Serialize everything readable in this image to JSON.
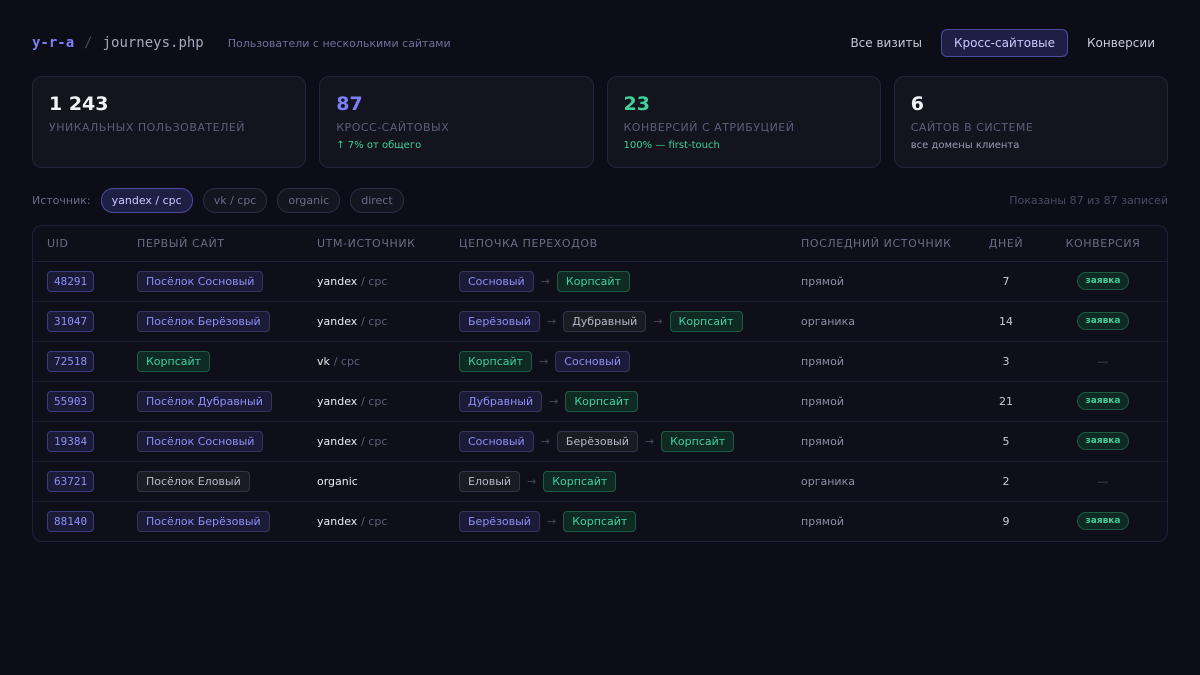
{
  "header": {
    "logo": "y-r-a",
    "separator": "/",
    "file": "journeys.php",
    "subtitle": "Пользователи с несколькими сайтами",
    "nav": [
      {
        "label": "Все визиты",
        "active": false
      },
      {
        "label": "Кросс-сайтовые",
        "active": true
      },
      {
        "label": "Конверсии",
        "active": false
      }
    ]
  },
  "stats": [
    {
      "value": "1 243",
      "label": "УНИКАЛЬНЫХ ПОЛЬЗОВАТЕЛЕЙ",
      "note": "",
      "color": "white"
    },
    {
      "value": "87",
      "label": "КРОСС-САЙТОВЫХ",
      "note": "↑ 7% от общего",
      "color": "blue"
    },
    {
      "value": "23",
      "label": "КОНВЕРСИЙ С АТРИБУЦИЕЙ",
      "note": "100% — first-touch",
      "color": "green"
    },
    {
      "value": "6",
      "label": "САЙТОВ В СИСТЕМЕ",
      "note": "все домены клиента",
      "color": "white"
    }
  ],
  "filters": {
    "label": "Источник:",
    "chips": [
      {
        "label": "yandex / cpc",
        "active": true
      },
      {
        "label": "vk / cpc",
        "active": false
      },
      {
        "label": "organic",
        "active": false
      },
      {
        "label": "direct",
        "active": false
      }
    ],
    "shown": "Показаны 87 из 87 записей"
  },
  "table": {
    "columns": [
      "UID",
      "ПЕРВЫЙ САЙТ",
      "UTM-ИСТОЧНИК",
      "ЦЕПОЧКА ПЕРЕХОДОВ",
      "ПОСЛЕДНИЙ ИСТОЧНИК",
      "ДНЕЙ",
      "КОНВЕРСИЯ"
    ],
    "rows": [
      {
        "uid": "48291",
        "first_site": {
          "label": "Посёлок Сосновый",
          "kind": "site"
        },
        "utm_source": "yandex",
        "utm_medium": "/ cpc",
        "chain": [
          {
            "label": "Сосновый",
            "kind": "site"
          },
          {
            "label": "Корпсайт",
            "kind": "corp"
          }
        ],
        "last_source": "прямой",
        "days": "7",
        "conversion": "заявка"
      },
      {
        "uid": "31047",
        "first_site": {
          "label": "Посёлок Берёзовый",
          "kind": "site"
        },
        "utm_source": "yandex",
        "utm_medium": "/ cpc",
        "chain": [
          {
            "label": "Берёзовый",
            "kind": "site"
          },
          {
            "label": "Дубравный",
            "kind": "neutral"
          },
          {
            "label": "Корпсайт",
            "kind": "corp"
          }
        ],
        "last_source": "органика",
        "days": "14",
        "conversion": "заявка"
      },
      {
        "uid": "72518",
        "first_site": {
          "label": "Корпсайт",
          "kind": "corp"
        },
        "utm_source": "vk",
        "utm_medium": "/ cpc",
        "chain": [
          {
            "label": "Корпсайт",
            "kind": "corp"
          },
          {
            "label": "Сосновый",
            "kind": "site"
          }
        ],
        "last_source": "прямой",
        "days": "3",
        "conversion": "—"
      },
      {
        "uid": "55903",
        "first_site": {
          "label": "Посёлок Дубравный",
          "kind": "site"
        },
        "utm_source": "yandex",
        "utm_medium": "/ cpc",
        "chain": [
          {
            "label": "Дубравный",
            "kind": "site"
          },
          {
            "label": "Корпсайт",
            "kind": "corp"
          }
        ],
        "last_source": "прямой",
        "days": "21",
        "conversion": "заявка"
      },
      {
        "uid": "19384",
        "first_site": {
          "label": "Посёлок Сосновый",
          "kind": "site"
        },
        "utm_source": "yandex",
        "utm_medium": "/ cpc",
        "chain": [
          {
            "label": "Сосновый",
            "kind": "site"
          },
          {
            "label": "Берёзовый",
            "kind": "neutral"
          },
          {
            "label": "Корпсайт",
            "kind": "corp"
          }
        ],
        "last_source": "прямой",
        "days": "5",
        "conversion": "заявка"
      },
      {
        "uid": "63721",
        "first_site": {
          "label": "Посёлок Еловый",
          "kind": "neutral"
        },
        "utm_source": "organic",
        "utm_medium": "",
        "chain": [
          {
            "label": "Еловый",
            "kind": "neutral"
          },
          {
            "label": "Корпсайт",
            "kind": "corp"
          }
        ],
        "last_source": "органика",
        "days": "2",
        "conversion": "—"
      },
      {
        "uid": "88140",
        "first_site": {
          "label": "Посёлок Берёзовый",
          "kind": "site"
        },
        "utm_source": "yandex",
        "utm_medium": "/ cpc",
        "chain": [
          {
            "label": "Берёзовый",
            "kind": "site"
          },
          {
            "label": "Корпсайт",
            "kind": "corp"
          }
        ],
        "last_source": "прямой",
        "days": "9",
        "conversion": "заявка"
      }
    ]
  },
  "colors": {
    "background": "#0d0d17",
    "accent": "#7c7ff5",
    "success": "#3ed19a"
  }
}
